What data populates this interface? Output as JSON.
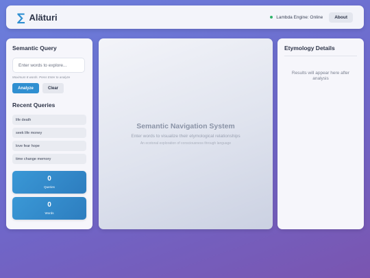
{
  "header": {
    "logo_icon": "sigma-icon",
    "logo_symbol": "∑",
    "title": "Aläturi",
    "status_text": "Lambda Engine: Online",
    "status_color": "#2fb36a",
    "about_label": "About"
  },
  "query": {
    "heading": "Semantic Query",
    "input_placeholder": "Enter words to explore...",
    "input_value": "",
    "hint": "Maximum 8 words. Press Enter to analyze",
    "analyze_label": "Analyze",
    "clear_label": "Clear"
  },
  "recent": {
    "heading": "Recent Queries",
    "items": [
      "life death",
      "seek life money",
      "love fear hope",
      "time change memory"
    ]
  },
  "stats": [
    {
      "value": "0",
      "label": "Queries"
    },
    {
      "value": "0",
      "label": "Words"
    }
  ],
  "center": {
    "title": "Semantic Navigation System",
    "subtitle": "Enter words to visualize their etymological relationships",
    "note": "An ecotonal exploration of consciousness through language"
  },
  "details": {
    "heading": "Etymology Details",
    "placeholder": "Results will appear here after analysis"
  },
  "colors": {
    "accent": "#2f8fd1",
    "status_online": "#2fb36a"
  }
}
